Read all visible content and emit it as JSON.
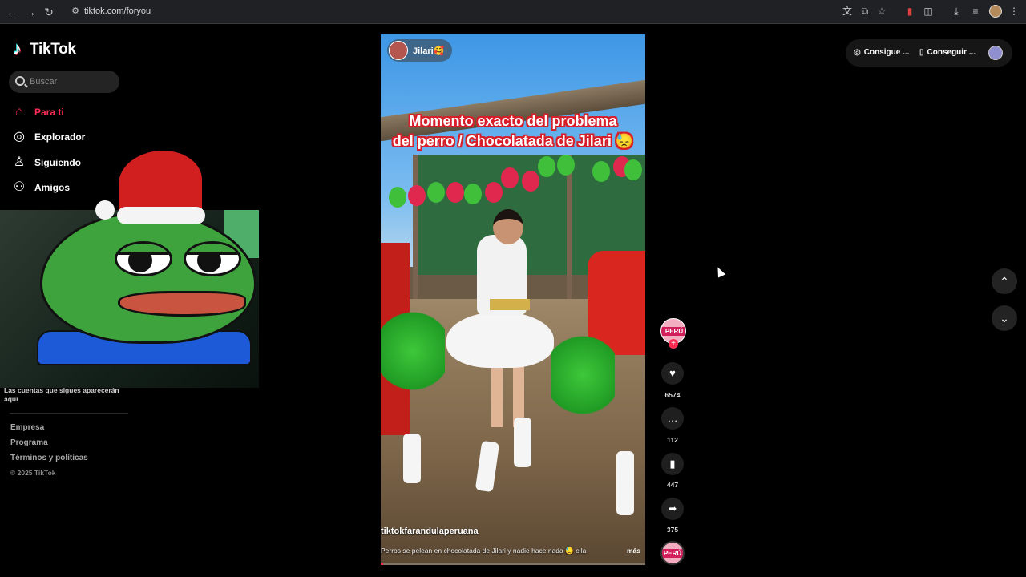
{
  "browser": {
    "url": "tiktok.com/foryou"
  },
  "sidebar": {
    "logo_text": "TikTok",
    "search_placeholder": "Buscar",
    "nav": [
      {
        "label": "Para ti",
        "icon": "home-icon",
        "active": true
      },
      {
        "label": "Explorador",
        "icon": "compass-icon",
        "active": false
      },
      {
        "label": "Siguiendo",
        "icon": "following-icon",
        "active": false
      },
      {
        "label": "Amigos",
        "icon": "friends-icon",
        "active": false
      }
    ],
    "following_hint": "Las cuentas que sigues aparecerán aquí",
    "footer_links": [
      "Empresa",
      "Programa",
      "Términos y políticas"
    ],
    "copyright": "© 2025 TikTok"
  },
  "video": {
    "creator_name": "Jilari🥰",
    "caption_line1": "Momento exacto del problema",
    "caption_line2": "del perro / Chocolatada de Jilari 😓",
    "username": "tiktokfarandulaperuana",
    "description": "Perros se pelean en chocolatada de Jilari y nadie hace nada 😓 ella",
    "more_label": "más",
    "progress": 0.01
  },
  "actions": {
    "avatar_label": "PERÚ",
    "likes": "6574",
    "comments": "112",
    "saves": "447",
    "shares": "375"
  },
  "topbar": {
    "get_coins_label": "Consigue ...",
    "get_app_label": "Conseguir ..."
  },
  "colors": {
    "accent": "#fe2c55",
    "background": "#000000"
  }
}
